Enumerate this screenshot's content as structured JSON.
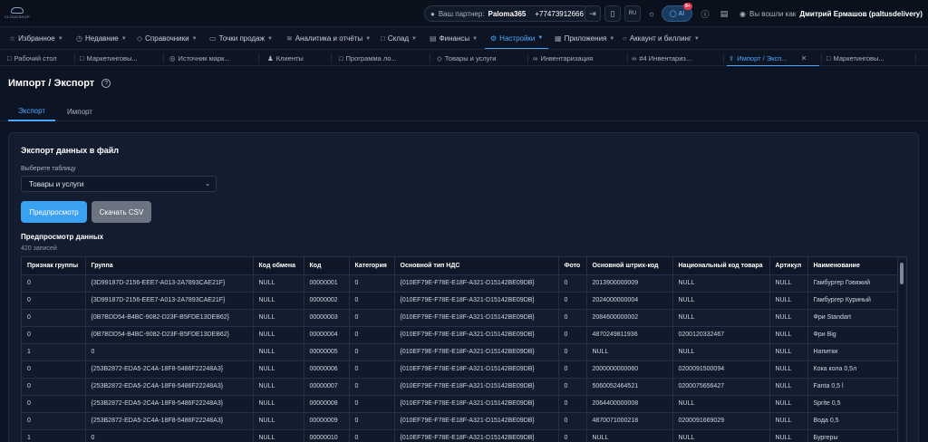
{
  "topbar": {
    "logo_text": "CLOUDSHOP",
    "partner_label": "Ваш партнер:",
    "partner_name": "Paloma365",
    "partner_phone": "+77473912666",
    "lang": "RU",
    "ai_label": "AI",
    "ai_badge": "9+",
    "user_prefix": "Вы вошли как",
    "user_name": "Дмитрий Ермашов (paltusdelivery)"
  },
  "nav": {
    "items": [
      {
        "label": "Избранное",
        "icon": "star-icon"
      },
      {
        "label": "Недавние",
        "icon": "clock-icon"
      },
      {
        "label": "Справочники",
        "icon": "tag-icon"
      },
      {
        "label": "Точки продаж",
        "icon": "monitor-icon"
      },
      {
        "label": "Аналитика и отчёты",
        "icon": "chart-icon"
      },
      {
        "label": "Склад",
        "icon": "box-icon"
      },
      {
        "label": "Финансы",
        "icon": "finance-icon"
      },
      {
        "label": "Настройки",
        "icon": "gear-icon",
        "active": true
      },
      {
        "label": "Приложения",
        "icon": "grid-icon"
      },
      {
        "label": "Аккаунт и биллинг",
        "icon": "user-icon"
      }
    ]
  },
  "tabs": [
    {
      "label": "Рабочий стол",
      "icon": "folder-icon"
    },
    {
      "label": "Маркетинговы...",
      "icon": "folder-icon"
    },
    {
      "label": "Источник марк...",
      "icon": "globe-icon"
    },
    {
      "label": "Клиенты",
      "icon": "users-icon"
    },
    {
      "label": "Программа ло...",
      "icon": "folder-icon"
    },
    {
      "label": "Товары и услуги",
      "icon": "tag-icon"
    },
    {
      "label": "Инвентаризация",
      "icon": "link-icon"
    },
    {
      "label": "#4 Инвентариз...",
      "icon": "link-icon"
    },
    {
      "label": "Импорт / Эксп...",
      "icon": "upload-icon",
      "active": true
    },
    {
      "label": "Маркетинговы...",
      "icon": "folder-icon"
    }
  ],
  "page": {
    "title": "Импорт / Экспорт",
    "subtabs": [
      "Экспорт",
      "Импорт"
    ]
  },
  "export": {
    "card_title": "Экспорт данных в файл",
    "select_label": "Выберите таблицу",
    "select_value": "Товары и услуги",
    "preview_button": "Предпросмотр",
    "csv_button": "Скачать CSV",
    "preview_title": "Предпросмотр данных",
    "record_count": "420 записей"
  },
  "table": {
    "columns": [
      "Признак группы",
      "Группа",
      "Код обмена",
      "Код",
      "Категория",
      "Основной тип НДС",
      "Фото",
      "Основной штрих-код",
      "Национальный код товара",
      "Артикул",
      "Наименование"
    ],
    "rows": [
      [
        "0",
        "{3D99187D-2156-EEE7-A013-2A7893CAE21F}",
        "NULL",
        "00000001",
        "0",
        "{010EF79E-F78E-E18F-A321-D15142BE09DB}",
        "0",
        "2013900000009",
        "NULL",
        "NULL",
        "Гамбургер Говяжий"
      ],
      [
        "0",
        "{3D99187D-2156-EEE7-A013-2A7893CAE21F}",
        "NULL",
        "00000002",
        "0",
        "{010EF79E-F78E-E18F-A321-D15142BE09DB}",
        "0",
        "2024000000004",
        "NULL",
        "NULL",
        "Гамбургер Куриный"
      ],
      [
        "0",
        "{0B7BDD54-B4BC-9082-D23F-B5FDE13DEB62}",
        "NULL",
        "00000003",
        "0",
        "{010EF79E-F78E-E18F-A321-D15142BE09DB}",
        "0",
        "2084600000002",
        "NULL",
        "NULL",
        "Фри Standart"
      ],
      [
        "0",
        "{0B7BDD54-B4BC-9082-D23F-B5FDE13DEB62}",
        "NULL",
        "00000004",
        "0",
        "{010EF79E-F78E-E18F-A321-D15142BE09DB}",
        "0",
        "4870249811936",
        "0200120332467",
        "NULL",
        "Фри Big"
      ],
      [
        "1",
        "0",
        "NULL",
        "00000005",
        "0",
        "{010EF79E-F78E-E18F-A321-D15142BE09DB}",
        "0",
        "NULL",
        "NULL",
        "NULL",
        "Напитки"
      ],
      [
        "0",
        "{253B2872-EDA5-2C4A-18F8-5486F22248A3}",
        "NULL",
        "00000006",
        "0",
        "{010EF79E-F78E-E18F-A321-D15142BE09DB}",
        "0",
        "2000000000060",
        "0200091500094",
        "NULL",
        "Кока кола 0,5л"
      ],
      [
        "0",
        "{253B2872-EDA5-2C4A-18F8-5486F22248A3}",
        "NULL",
        "00000007",
        "0",
        "{010EF79E-F78E-E18F-A321-D15142BE09DB}",
        "0",
        "5060052464521",
        "0200075656427",
        "NULL",
        "Fanta 0,5 l"
      ],
      [
        "0",
        "{253B2872-EDA5-2C4A-18F8-5486F22248A3}",
        "NULL",
        "00000008",
        "0",
        "{010EF79E-F78E-E18F-A321-D15142BE09DB}",
        "0",
        "2064400000008",
        "NULL",
        "NULL",
        "Sprite 0,5"
      ],
      [
        "0",
        "{253B2872-EDA5-2C4A-18F8-5486F22248A3}",
        "NULL",
        "00000009",
        "0",
        "{010EF79E-F78E-E18F-A321-D15142BE09DB}",
        "0",
        "4870071000218",
        "0200091669029",
        "NULL",
        "Вода 0,5"
      ],
      [
        "1",
        "0",
        "NULL",
        "00000010",
        "0",
        "{010EF79E-F78E-E18F-A321-D15142BE09DB}",
        "0",
        "NULL",
        "NULL",
        "NULL",
        "Бургеры"
      ]
    ]
  }
}
